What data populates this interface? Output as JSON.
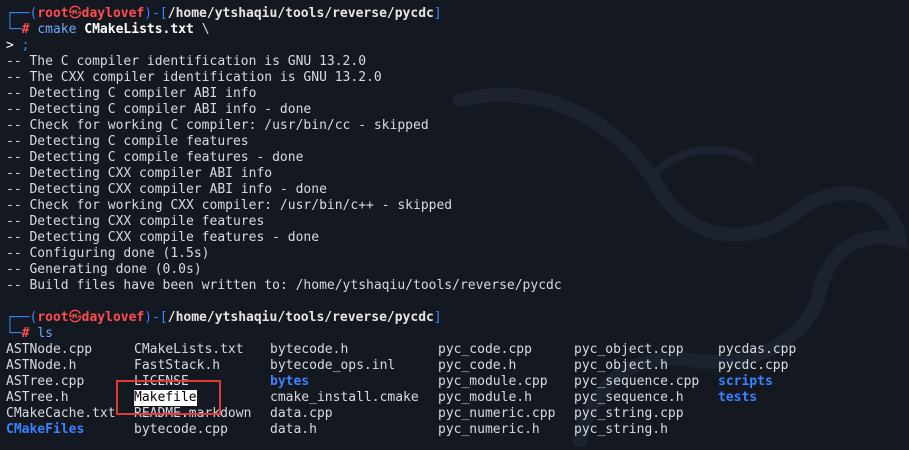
{
  "prompt": {
    "user": "root",
    "host": "daylovef",
    "path": "/home/ytshaqiu/tools/reverse/pycdc",
    "symbol": "#"
  },
  "command1": {
    "cmd": "cmake",
    "arg": "CMakeLists.txt",
    "tail": "\\",
    "continuation_prompt": ">",
    "continuation_text": ";"
  },
  "output": [
    "-- The C compiler identification is GNU 13.2.0",
    "-- The CXX compiler identification is GNU 13.2.0",
    "-- Detecting C compiler ABI info",
    "-- Detecting C compiler ABI info - done",
    "-- Check for working C compiler: /usr/bin/cc - skipped",
    "-- Detecting C compile features",
    "-- Detecting C compile features - done",
    "-- Detecting CXX compiler ABI info",
    "-- Detecting CXX compiler ABI info - done",
    "-- Check for working CXX compiler: /usr/bin/c++ - skipped",
    "-- Detecting CXX compile features",
    "-- Detecting CXX compile features - done",
    "-- Configuring done (1.5s)",
    "-- Generating done (0.0s)",
    "-- Build files have been written to: /home/ytshaqiu/tools/reverse/pycdc"
  ],
  "command2": {
    "cmd": "ls"
  },
  "ls_columns": [
    [
      {
        "name": "ASTNode.cpp"
      },
      {
        "name": "ASTNode.h"
      },
      {
        "name": "ASTree.cpp"
      },
      {
        "name": "ASTree.h"
      },
      {
        "name": "CMakeCache.txt"
      },
      {
        "name": "CMakeFiles",
        "dir": true
      }
    ],
    [
      {
        "name": "CMakeLists.txt"
      },
      {
        "name": "FastStack.h"
      },
      {
        "name": "LICENSE"
      },
      {
        "name": "Makefile",
        "highlight": true
      },
      {
        "name": "README.markdown"
      },
      {
        "name": "bytecode.cpp"
      }
    ],
    [
      {
        "name": "bytecode.h"
      },
      {
        "name": "bytecode_ops.inl"
      },
      {
        "name": "bytes",
        "dir": true
      },
      {
        "name": "cmake_install.cmake"
      },
      {
        "name": "data.cpp"
      },
      {
        "name": "data.h"
      }
    ],
    [
      {
        "name": "pyc_code.cpp"
      },
      {
        "name": "pyc_code.h"
      },
      {
        "name": "pyc_module.cpp"
      },
      {
        "name": "pyc_module.h"
      },
      {
        "name": "pyc_numeric.cpp"
      },
      {
        "name": "pyc_numeric.h"
      }
    ],
    [
      {
        "name": "pyc_object.cpp"
      },
      {
        "name": "pyc_object.h"
      },
      {
        "name": "pyc_sequence.cpp"
      },
      {
        "name": "pyc_sequence.h"
      },
      {
        "name": "pyc_string.cpp"
      },
      {
        "name": "pyc_string.h"
      }
    ],
    [
      {
        "name": "pycdas.cpp"
      },
      {
        "name": "pycdc.cpp"
      },
      {
        "name": "scripts",
        "dir": true
      },
      {
        "name": "tests",
        "dir": true
      }
    ]
  ],
  "colors": {
    "background": "#141821",
    "prompt_frame": "#2f8cff",
    "prompt_user": "#ff4d4d",
    "directory": "#3b82ff",
    "highlight_box": "#e53935"
  }
}
